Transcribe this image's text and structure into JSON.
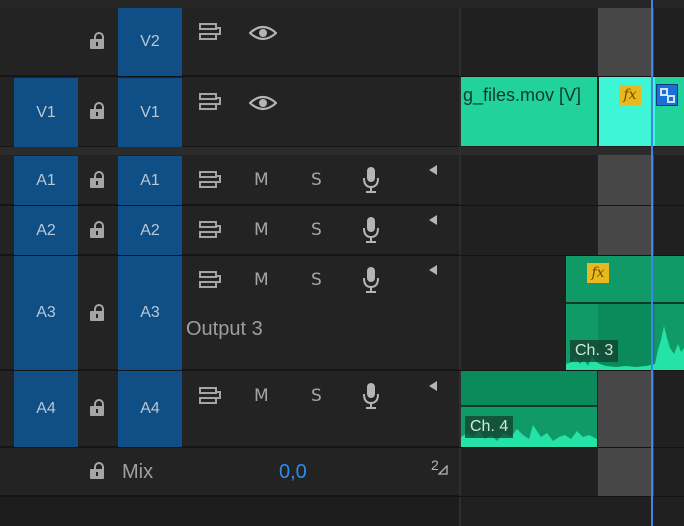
{
  "colors": {
    "accent_blue": "#2d8ceb",
    "clip_green": "#21d29a",
    "clip_dark": "#0b8a5c",
    "fx_yellow": "#e9b81e"
  },
  "tracks": {
    "V2": {
      "target": "V2",
      "source": ""
    },
    "V1": {
      "target": "V1",
      "source": "V1"
    },
    "A1": {
      "target": "A1",
      "source": "A1",
      "m": "M",
      "s": "S"
    },
    "A2": {
      "target": "A2",
      "source": "A2",
      "m": "M",
      "s": "S"
    },
    "A3": {
      "target": "A3",
      "source": "A3",
      "m": "M",
      "s": "S",
      "output": "Output 3"
    },
    "A4": {
      "target": "A4",
      "source": "A4",
      "m": "M",
      "s": "S"
    }
  },
  "mix": {
    "label": "Mix",
    "value": "0,0",
    "channels": "2"
  },
  "clips": {
    "video_name": "g_files.mov [V]",
    "fx": "fx",
    "ch3": "Ch. 3",
    "ch4": "Ch. 4"
  }
}
